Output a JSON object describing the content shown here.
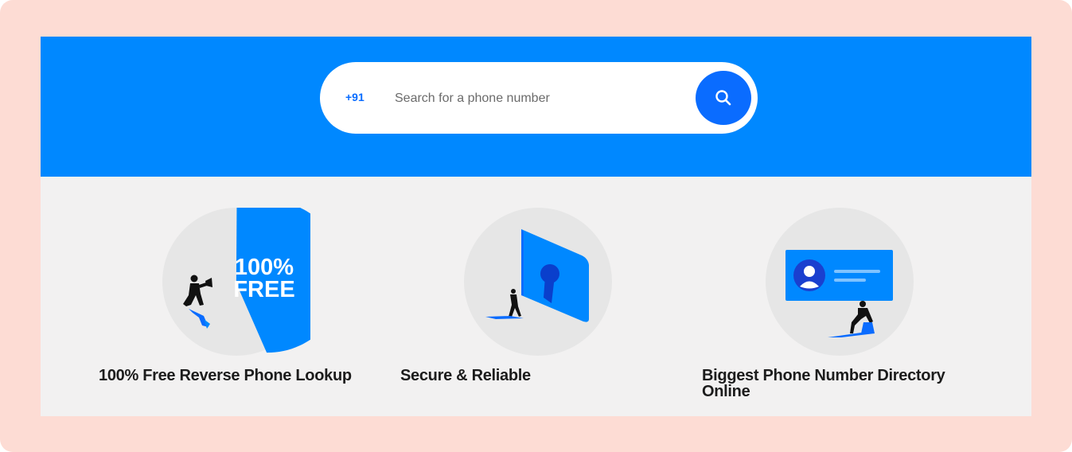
{
  "search": {
    "country_code": "+91",
    "placeholder": "Search for a phone number",
    "value": "",
    "button_icon": "search-icon"
  },
  "illustrations": {
    "free": {
      "badge_line1": "100%",
      "badge_line2": "FREE"
    }
  },
  "features": [
    {
      "title": "100% Free Reverse Phone Lookup",
      "icon": "free-badge-illustration"
    },
    {
      "title": "Secure & Reliable",
      "icon": "keyhole-door-illustration"
    },
    {
      "title": "Biggest Phone Number Directory Online",
      "icon": "contact-card-illustration"
    }
  ],
  "colors": {
    "frame": "#fddcd4",
    "hero": "#0088ff",
    "accent": "#0a6cff",
    "features_bg": "#f2f1f1",
    "circle": "#e6e6e6",
    "text": "#1c1c1c"
  }
}
